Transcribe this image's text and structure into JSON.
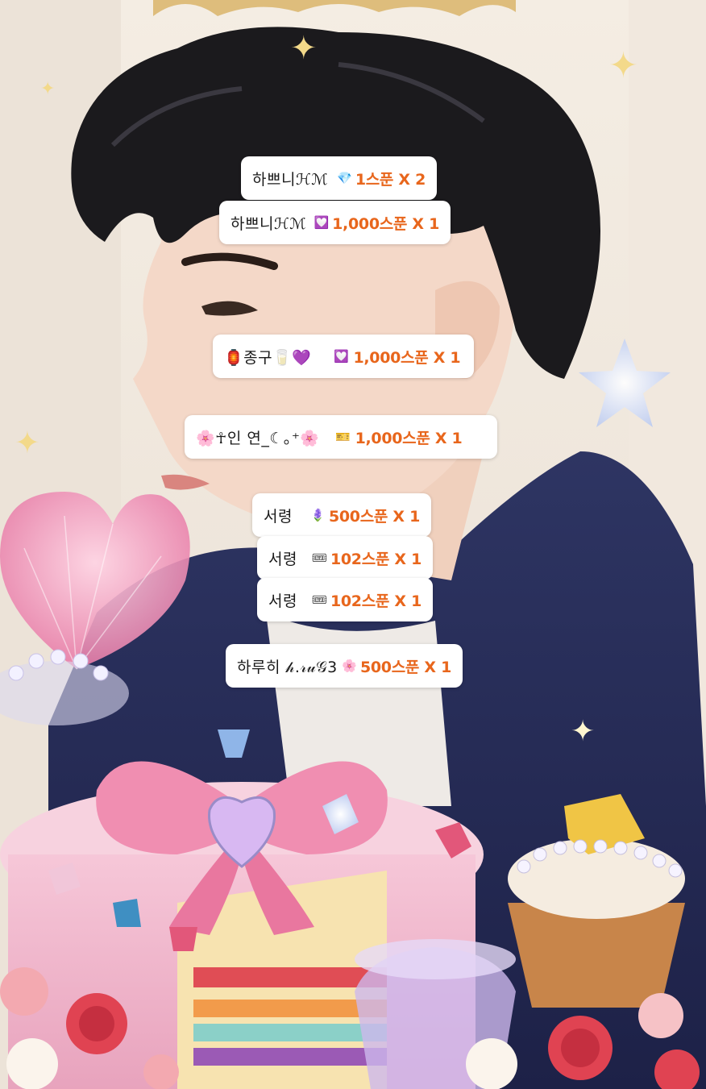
{
  "gifts": [
    {
      "sender": "하쁘니ℋℳ",
      "icon": "💎",
      "icon_name": "crystal-icon",
      "amount": "1스푼 X 2"
    },
    {
      "sender": "하쁘니ℋℳ",
      "icon": "💟",
      "icon_name": "heart-gem-icon",
      "amount": "1,000스푼 X 1"
    },
    {
      "sender": "🏮종구🥛💜",
      "icon": "💟",
      "icon_name": "heart-gem-icon",
      "amount": "1,000스푼 X 1"
    },
    {
      "sender": "🌸☥인 연_☾｡⁺🌸",
      "icon": "🎫",
      "icon_name": "ticket-icon",
      "amount": "1,000스푼 X 1"
    },
    {
      "sender": "서령",
      "icon": "🪻",
      "icon_name": "flower-icon",
      "amount": "500스푼 X 1"
    },
    {
      "sender": "서령",
      "icon": "🎟",
      "icon_name": "coupon-icon",
      "amount": "102스푼 X 1"
    },
    {
      "sender": "서령",
      "icon": "🎟",
      "icon_name": "coupon-icon",
      "amount": "102스푼 X 1"
    },
    {
      "sender": "하루히 𝒽.𝓇𝓊𝒢3",
      "icon": "🌸",
      "icon_name": "blossom-icon",
      "amount": "500스푼 X 1"
    }
  ],
  "colors": {
    "amount": "#e8661c",
    "chip_bg": "#ffffff",
    "wall": "#efe6dc"
  }
}
